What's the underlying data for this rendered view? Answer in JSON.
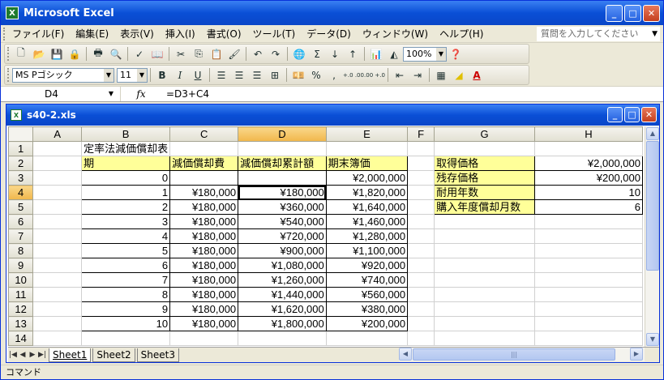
{
  "app": {
    "title": "Microsoft Excel",
    "icon_label": "X"
  },
  "window_buttons": {
    "minimize": "_",
    "maximize": "□",
    "close": "✕"
  },
  "menu": {
    "items": [
      "ファイル(F)",
      "編集(E)",
      "表示(V)",
      "挿入(I)",
      "書式(O)",
      "ツール(T)",
      "データ(D)",
      "ウィンドウ(W)",
      "ヘルプ(H)"
    ],
    "help_placeholder": "質問を入力してください"
  },
  "toolbar": {
    "zoom": "100%",
    "font_name": "MS Pゴシック",
    "font_size": "11",
    "bold": "B",
    "italic": "I",
    "underline": "U",
    "sigma": "Σ",
    "percent": "%",
    "comma": ",",
    "inc_decimal": "+.0 .00",
    "dec_decimal": ".00 +.0"
  },
  "formula_bar": {
    "name_box": "D4",
    "fx": "fx",
    "formula": "=D3+C4"
  },
  "workbook": {
    "title": "s40-2.xls",
    "icon_label": "X",
    "columns": [
      "A",
      "B",
      "C",
      "D",
      "E",
      "F",
      "G",
      "H"
    ],
    "active_column": "D",
    "active_row": 4,
    "rows": [
      1,
      2,
      3,
      4,
      5,
      6,
      7,
      8,
      9,
      10,
      11,
      12,
      13,
      14
    ],
    "table_title": "定率法減価償却表",
    "headers": {
      "period": "期",
      "depreciation": "減価償却費",
      "cumulative": "減価償却累計額",
      "book_value": "期末簿価"
    },
    "schedule": [
      {
        "period": "0",
        "depreciation": "",
        "cumulative": "",
        "book_value": "¥2,000,000"
      },
      {
        "period": "1",
        "depreciation": "¥180,000",
        "cumulative": "¥180,000",
        "book_value": "¥1,820,000"
      },
      {
        "period": "2",
        "depreciation": "¥180,000",
        "cumulative": "¥360,000",
        "book_value": "¥1,640,000"
      },
      {
        "period": "3",
        "depreciation": "¥180,000",
        "cumulative": "¥540,000",
        "book_value": "¥1,460,000"
      },
      {
        "period": "4",
        "depreciation": "¥180,000",
        "cumulative": "¥720,000",
        "book_value": "¥1,280,000"
      },
      {
        "period": "5",
        "depreciation": "¥180,000",
        "cumulative": "¥900,000",
        "book_value": "¥1,100,000"
      },
      {
        "period": "6",
        "depreciation": "¥180,000",
        "cumulative": "¥1,080,000",
        "book_value": "¥920,000"
      },
      {
        "period": "7",
        "depreciation": "¥180,000",
        "cumulative": "¥1,260,000",
        "book_value": "¥740,000"
      },
      {
        "period": "8",
        "depreciation": "¥180,000",
        "cumulative": "¥1,440,000",
        "book_value": "¥560,000"
      },
      {
        "period": "9",
        "depreciation": "¥180,000",
        "cumulative": "¥1,620,000",
        "book_value": "¥380,000"
      },
      {
        "period": "10",
        "depreciation": "¥180,000",
        "cumulative": "¥1,800,000",
        "book_value": "¥200,000"
      }
    ],
    "params": [
      {
        "label": "取得価格",
        "value": "¥2,000,000"
      },
      {
        "label": "残存価格",
        "value": "¥200,000"
      },
      {
        "label": "耐用年数",
        "value": "10"
      },
      {
        "label": "購入年度償却月数",
        "value": "6"
      }
    ],
    "sheets": [
      "Sheet1",
      "Sheet2",
      "Sheet3"
    ],
    "active_sheet": "Sheet1"
  },
  "status": {
    "mode": "コマンド"
  },
  "colors": {
    "title_bar": "#0a4fd6",
    "highlight": "#ffff99",
    "active_header": "#f1b74b"
  }
}
